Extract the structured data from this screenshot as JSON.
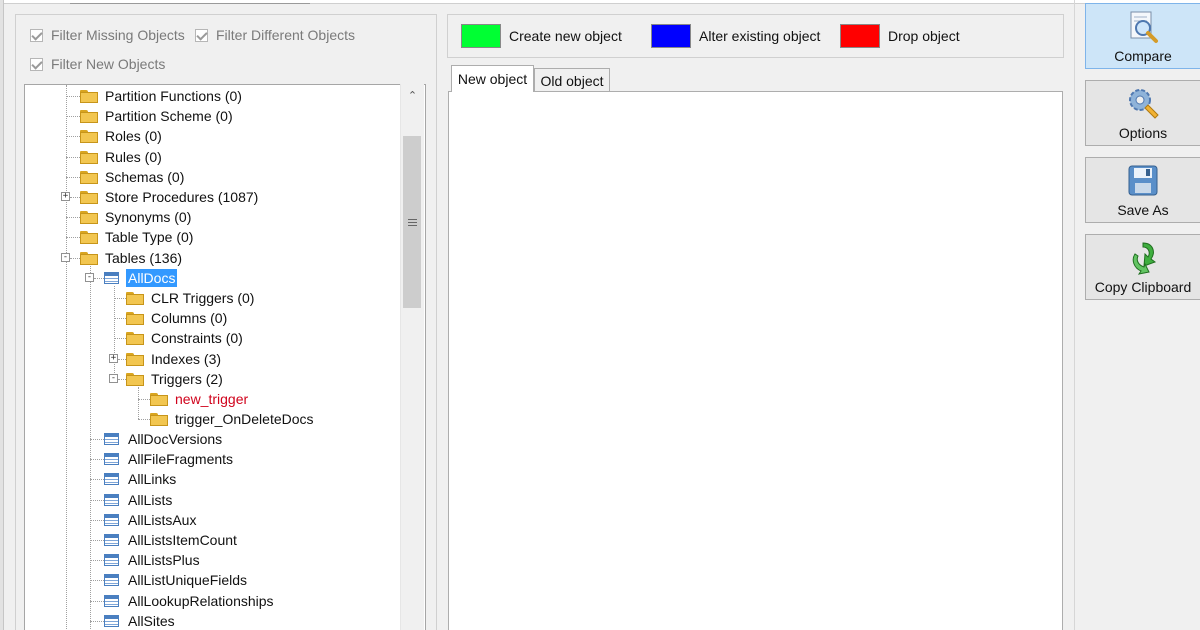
{
  "filters": [
    {
      "label": "Filter Missing Objects",
      "checked": true
    },
    {
      "label": "Filter Different Objects",
      "checked": true
    },
    {
      "label": "Filter New Objects",
      "checked": true
    }
  ],
  "legend": [
    {
      "label": "Create new object",
      "color": "#00ff33"
    },
    {
      "label": "Alter existing object",
      "color": "#0000ff"
    },
    {
      "label": "Drop object",
      "color": "#ff0000"
    }
  ],
  "tabs": [
    {
      "label": "New object",
      "active": true
    },
    {
      "label": "Old object",
      "active": false
    }
  ],
  "tree": [
    {
      "label": "Partition Functions (0)",
      "icon": "folder-icon"
    },
    {
      "label": "Partition Scheme (0)",
      "icon": "folder-icon"
    },
    {
      "label": "Roles (0)",
      "icon": "folder-icon"
    },
    {
      "label": "Rules (0)",
      "icon": "folder-icon"
    },
    {
      "label": "Schemas (0)",
      "icon": "folder-icon"
    },
    {
      "label": "Store Procedures (1087)",
      "icon": "folder-icon",
      "expander": "+"
    },
    {
      "label": "Synonyms (0)",
      "icon": "folder-icon"
    },
    {
      "label": "Table Type (0)",
      "icon": "folder-icon"
    },
    {
      "label": "Tables (136)",
      "icon": "folder-icon",
      "expander": "-"
    },
    {
      "label": "AllDocs",
      "icon": "table-icon",
      "expander": "-",
      "selected": true
    },
    {
      "label": "CLR Triggers (0)",
      "icon": "folder-icon"
    },
    {
      "label": "Columns (0)",
      "icon": "folder-icon"
    },
    {
      "label": "Constraints (0)",
      "icon": "folder-icon"
    },
    {
      "label": "Indexes (3)",
      "icon": "folder-icon",
      "expander": "+"
    },
    {
      "label": "Triggers (2)",
      "icon": "folder-icon",
      "expander": "-"
    },
    {
      "label": "new_trigger",
      "icon": "folder-icon",
      "status": "new",
      "status_color": "#d0021b"
    },
    {
      "label": "trigger_OnDeleteDocs",
      "icon": "folder-icon"
    },
    {
      "label": "AllDocVersions",
      "icon": "table-icon"
    },
    {
      "label": "AllFileFragments",
      "icon": "table-icon"
    },
    {
      "label": "AllLinks",
      "icon": "table-icon"
    },
    {
      "label": "AllLists",
      "icon": "table-icon"
    },
    {
      "label": "AllListsAux",
      "icon": "table-icon"
    },
    {
      "label": "AllListsItemCount",
      "icon": "table-icon"
    },
    {
      "label": "AllListsPlus",
      "icon": "table-icon"
    },
    {
      "label": "AllListUniqueFields",
      "icon": "table-icon"
    },
    {
      "label": "AllLookupRelationships",
      "icon": "table-icon"
    },
    {
      "label": "AllSites",
      "icon": "table-icon"
    }
  ],
  "actions": [
    {
      "label": "Compare",
      "icon": "compare-magnifier-icon",
      "active": true
    },
    {
      "label": "Options",
      "icon": "options-gear-icon",
      "active": false
    },
    {
      "label": "Save As",
      "icon": "floppy-disk-icon",
      "active": false
    },
    {
      "label": "Copy Clipboard",
      "icon": "clipboard-arrow-icon",
      "active": false
    }
  ],
  "accent_color": "#3399ff"
}
